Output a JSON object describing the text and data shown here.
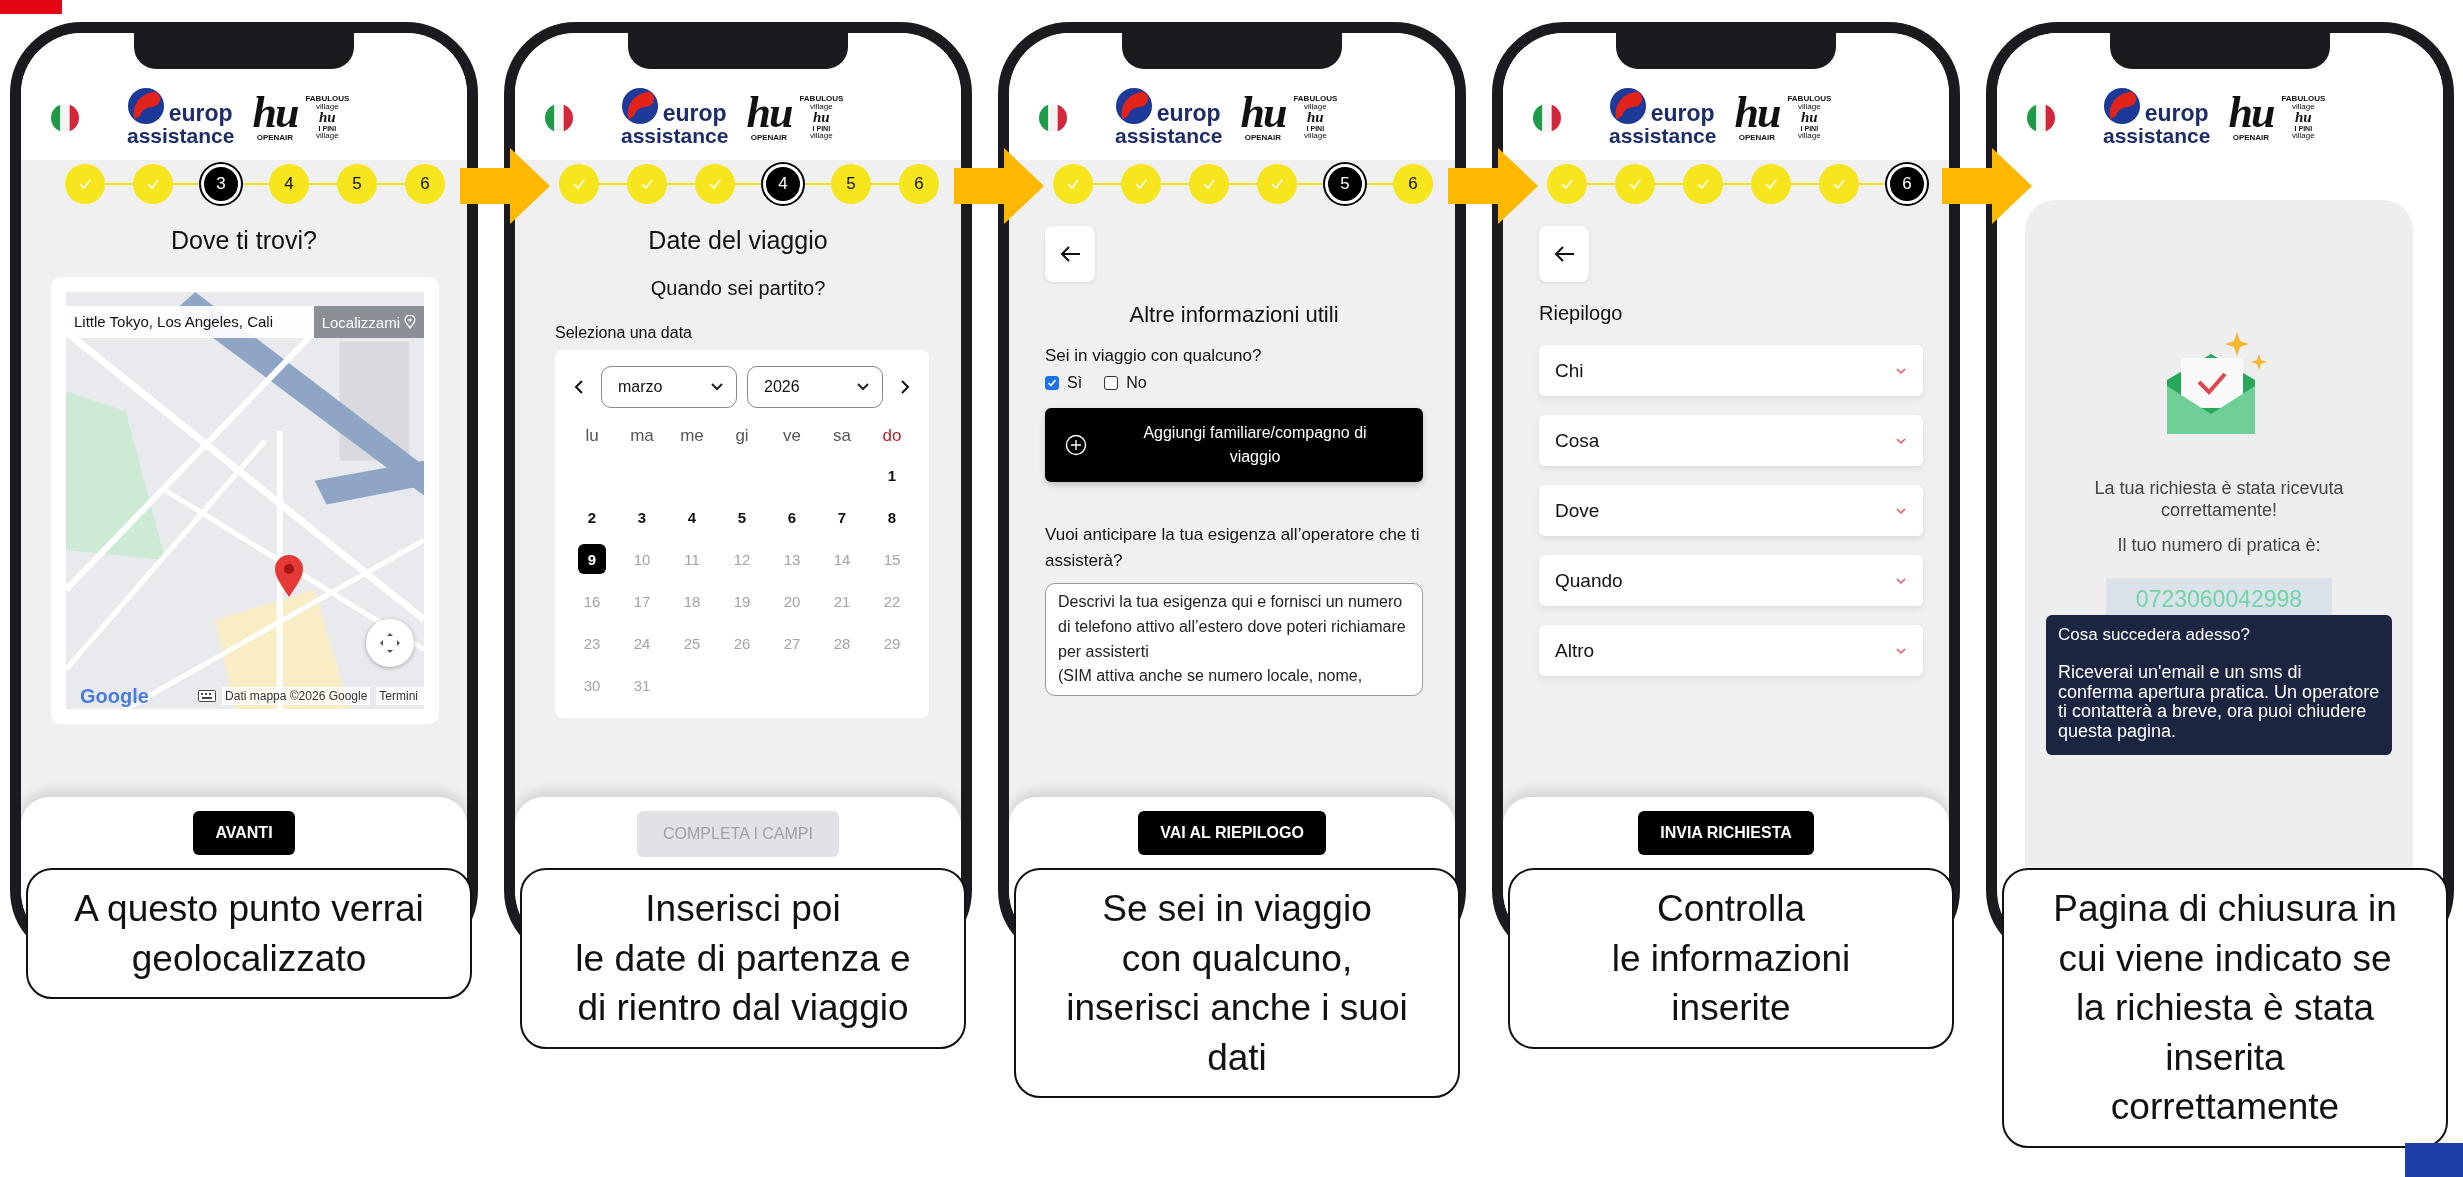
{
  "phones": [
    {
      "kind": "location",
      "header": {
        "brand_top": "europ",
        "brand_bottom": "assistance",
        "partner_1": "hu",
        "partner_1_sub": "OPENAIR",
        "partner_2_top": "FABULOUS",
        "partner_2_tag_1": "village",
        "partner_2_mark": "hu",
        "partner_2_name": "I PINI",
        "partner_2_tag_2": "village"
      },
      "steps": [
        {
          "done": true,
          "current": false
        },
        {
          "done": true,
          "current": false
        },
        {
          "done": false,
          "current": true,
          "label": "3"
        },
        {
          "done": false,
          "current": false,
          "label": "4"
        },
        {
          "done": false,
          "current": false,
          "label": "5"
        },
        {
          "done": false,
          "current": false,
          "label": "6"
        }
      ],
      "title": "Dove ti trovi?",
      "map": {
        "kind": "picture",
        "address_value": "Little Tokyo, Los Angeles, Cali",
        "locate_button": "Localizzami",
        "logo": "Google",
        "attribution": "Dati mappa ©2026 Google",
        "terms": "Termini"
      },
      "footer_button": {
        "label": "AVANTI",
        "disabled": false
      },
      "caption": "A questo punto verrai\ngeolocalizzato"
    },
    {
      "kind": "calendar",
      "header": {
        "brand_top": "europ",
        "brand_bottom": "assistance",
        "partner_1": "hu",
        "partner_1_sub": "OPENAIR",
        "partner_2_top": "FABULOUS",
        "partner_2_tag_1": "village",
        "partner_2_mark": "hu",
        "partner_2_name": "I PINI",
        "partner_2_tag_2": "village"
      },
      "steps": [
        {
          "done": true,
          "current": false
        },
        {
          "done": true,
          "current": false
        },
        {
          "done": true,
          "current": false
        },
        {
          "done": false,
          "current": true,
          "label": "4"
        },
        {
          "done": false,
          "current": false,
          "label": "5"
        },
        {
          "done": false,
          "current": false,
          "label": "6"
        }
      ],
      "title": "Date del viaggio",
      "subtitle": "Quando sei partito?",
      "field_label": "Seleziona una data",
      "calendar": {
        "month": "marzo",
        "year": "2026",
        "weekdays": [
          {
            "label": "lu",
            "holiday": false
          },
          {
            "label": "ma",
            "holiday": false
          },
          {
            "label": "me",
            "holiday": false
          },
          {
            "label": "gi",
            "holiday": false
          },
          {
            "label": "ve",
            "holiday": false
          },
          {
            "label": "sa",
            "holiday": false
          },
          {
            "label": "do",
            "holiday": true
          }
        ],
        "weeks": [
          {
            "days": [
              {
                "label": "1",
                "selected": false,
                "disabled": false
              }
            ]
          },
          {
            "days": [
              {
                "label": "2",
                "selected": false,
                "disabled": false
              },
              {
                "label": "3",
                "selected": false,
                "disabled": false
              },
              {
                "label": "4",
                "selected": false,
                "disabled": false
              },
              {
                "label": "5",
                "selected": false,
                "disabled": false
              },
              {
                "label": "6",
                "selected": false,
                "disabled": false
              },
              {
                "label": "7",
                "selected": false,
                "disabled": false
              },
              {
                "label": "8",
                "selected": false,
                "disabled": false
              }
            ]
          },
          {
            "days": [
              {
                "label": "9",
                "selected": true,
                "disabled": false
              },
              {
                "label": "10",
                "selected": false,
                "disabled": true
              },
              {
                "label": "11",
                "selected": false,
                "disabled": true
              },
              {
                "label": "12",
                "selected": false,
                "disabled": true
              },
              {
                "label": "13",
                "selected": false,
                "disabled": true
              },
              {
                "label": "14",
                "selected": false,
                "disabled": true
              },
              {
                "label": "15",
                "selected": false,
                "disabled": true
              }
            ]
          },
          {
            "days": [
              {
                "label": "16",
                "selected": false,
                "disabled": true
              },
              {
                "label": "17",
                "selected": false,
                "disabled": true
              },
              {
                "label": "18",
                "selected": false,
                "disabled": true
              },
              {
                "label": "19",
                "selected": false,
                "disabled": true
              },
              {
                "label": "20",
                "selected": false,
                "disabled": true
              },
              {
                "label": "21",
                "selected": false,
                "disabled": true
              },
              {
                "label": "22",
                "selected": false,
                "disabled": true
              }
            ]
          },
          {
            "days": [
              {
                "label": "23",
                "selected": false,
                "disabled": true
              },
              {
                "label": "24",
                "selected": false,
                "disabled": true
              },
              {
                "label": "25",
                "selected": false,
                "disabled": true
              },
              {
                "label": "26",
                "selected": false,
                "disabled": true
              },
              {
                "label": "27",
                "selected": false,
                "disabled": true
              },
              {
                "label": "28",
                "selected": false,
                "disabled": true
              },
              {
                "label": "29",
                "selected": false,
                "disabled": true
              }
            ]
          },
          {
            "days": [
              {
                "label": "30",
                "selected": false,
                "disabled": true
              },
              {
                "label": "31",
                "selected": false,
                "disabled": true
              }
            ]
          }
        ]
      },
      "footer_button": {
        "label": "COMPLETA I CAMPI",
        "disabled": true
      },
      "caption": "Inserisci poi\nle date di partenza e\ndi rientro dal viaggio"
    },
    {
      "kind": "companions",
      "header": {
        "brand_top": "europ",
        "brand_bottom": "assistance",
        "partner_1": "hu",
        "partner_1_sub": "OPENAIR",
        "partner_2_top": "FABULOUS",
        "partner_2_tag_1": "village",
        "partner_2_mark": "hu",
        "partner_2_name": "I PINI",
        "partner_2_tag_2": "village"
      },
      "steps": [
        {
          "done": true,
          "current": false
        },
        {
          "done": true,
          "current": false
        },
        {
          "done": true,
          "current": false
        },
        {
          "done": true,
          "current": false
        },
        {
          "done": false,
          "current": true,
          "label": "5"
        },
        {
          "done": false,
          "current": false,
          "label": "6"
        }
      ],
      "title": "Altre informazioni utili",
      "question": "Sei in viaggio con qualcuno?",
      "options": [
        {
          "label": "Sì",
          "checked": true
        },
        {
          "label": "No",
          "checked": false
        }
      ],
      "add_button": "Aggiungi familiare/compagno di viaggio",
      "message_label": "Vuoi anticipare la tua esigenza all’operatore che ti assisterà?",
      "message_field": {
        "placeholder": "Descrivi la tua esigenza qui e fornisci un numero di telefono attivo all’estero dove poteri richiamare per assisterti\n(SIM attiva anche se numero locale, nome,"
      },
      "footer_button": {
        "label": "VAI AL RIEPILOGO",
        "disabled": false
      },
      "caption": "Se sei in viaggio\ncon qualcuno,\ninserisci anche i suoi\ndati"
    },
    {
      "kind": "summary",
      "header": {
        "brand_top": "europ",
        "brand_bottom": "assistance",
        "partner_1": "hu",
        "partner_1_sub": "OPENAIR",
        "partner_2_top": "FABULOUS",
        "partner_2_tag_1": "village",
        "partner_2_mark": "hu",
        "partner_2_name": "I PINI",
        "partner_2_tag_2": "village"
      },
      "steps": [
        {
          "done": true,
          "current": false
        },
        {
          "done": true,
          "current": false
        },
        {
          "done": true,
          "current": false
        },
        {
          "done": true,
          "current": false
        },
        {
          "done": true,
          "current": false
        },
        {
          "done": false,
          "current": true,
          "label": "6"
        }
      ],
      "title": "Riepilogo",
      "sections": [
        {
          "label": "Chi",
          "expanded": false
        },
        {
          "label": "Cosa",
          "expanded": false
        },
        {
          "label": "Dove",
          "expanded": false
        },
        {
          "label": "Quando",
          "expanded": false
        },
        {
          "label": "Altro",
          "expanded": false
        }
      ],
      "footer_button": {
        "label": "INVIA RICHIESTA",
        "disabled": false
      },
      "caption": "Controlla\nle informazioni\ninserite"
    },
    {
      "kind": "confirmation",
      "header": {
        "brand_top": "europ",
        "brand_bottom": "assistance",
        "partner_1": "hu",
        "partner_1_sub": "OPENAIR",
        "partner_2_top": "FABULOUS",
        "partner_2_tag_1": "village",
        "partner_2_mark": "hu",
        "partner_2_name": "I PINI",
        "partner_2_tag_2": "village"
      },
      "message": "La tua richiesta è stata ricevuta correttamente!",
      "number_label": "Il tuo numero di pratica è:",
      "number": "0723060042998",
      "info": {
        "title": "Cosa succedera adesso?",
        "body": "Riceverai un'email e un sms di conferma apertura pratica. Un operatore ti contatterà a breve, ora puoi chiudere questa pagina."
      },
      "caption": "Pagina di chiusura in\ncui viene indicato se\nla richiesta è stata\ninserita\ncorrettamente"
    }
  ]
}
